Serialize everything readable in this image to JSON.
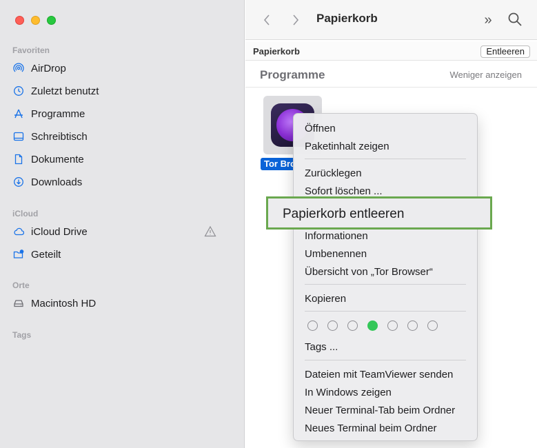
{
  "window": {
    "title": "Papierkorb"
  },
  "sidebar": {
    "favorites_title": "Favoriten",
    "favorites": [
      {
        "label": "AirDrop",
        "icon": "airdrop-icon"
      },
      {
        "label": "Zuletzt benutzt",
        "icon": "clock-icon"
      },
      {
        "label": "Programme",
        "icon": "apps-icon"
      },
      {
        "label": "Schreibtisch",
        "icon": "desktop-icon"
      },
      {
        "label": "Dokumente",
        "icon": "document-icon"
      },
      {
        "label": "Downloads",
        "icon": "download-icon"
      }
    ],
    "icloud_title": "iCloud",
    "icloud": [
      {
        "label": "iCloud Drive",
        "icon": "cloud-icon"
      },
      {
        "label": "Geteilt",
        "icon": "shared-folder-icon"
      }
    ],
    "places_title": "Orte",
    "places": [
      {
        "label": "Macintosh HD",
        "icon": "disk-icon"
      }
    ],
    "tags_title": "Tags"
  },
  "toolbar": {
    "more_glyph": "»"
  },
  "pathbar": {
    "label": "Papierkorb",
    "empty_button": "Entleeren"
  },
  "group": {
    "title": "Programme",
    "show_less": "Weniger anzeigen"
  },
  "file": {
    "label": "Tor Browser"
  },
  "context_menu": {
    "items": [
      "Öffnen",
      "Paketinhalt zeigen",
      "Zurücklegen",
      "Sofort löschen ...",
      "Informationen",
      "Umbenennen",
      "Übersicht von „Tor Browser“",
      "Kopieren",
      "Tags ...",
      "Dateien mit TeamViewer senden",
      "In Windows zeigen",
      "Neuer Terminal-Tab beim Ordner",
      "Neues Terminal beim Ordner"
    ],
    "highlighted_item": "Papierkorb entleeren",
    "tag_colors": [
      "none",
      "none",
      "none",
      "#34c759",
      "none",
      "none",
      "none"
    ]
  },
  "colors": {
    "accent": "#0a63d8",
    "highlight_border": "#6aa84f",
    "icon_blue": "#1a73e8"
  }
}
